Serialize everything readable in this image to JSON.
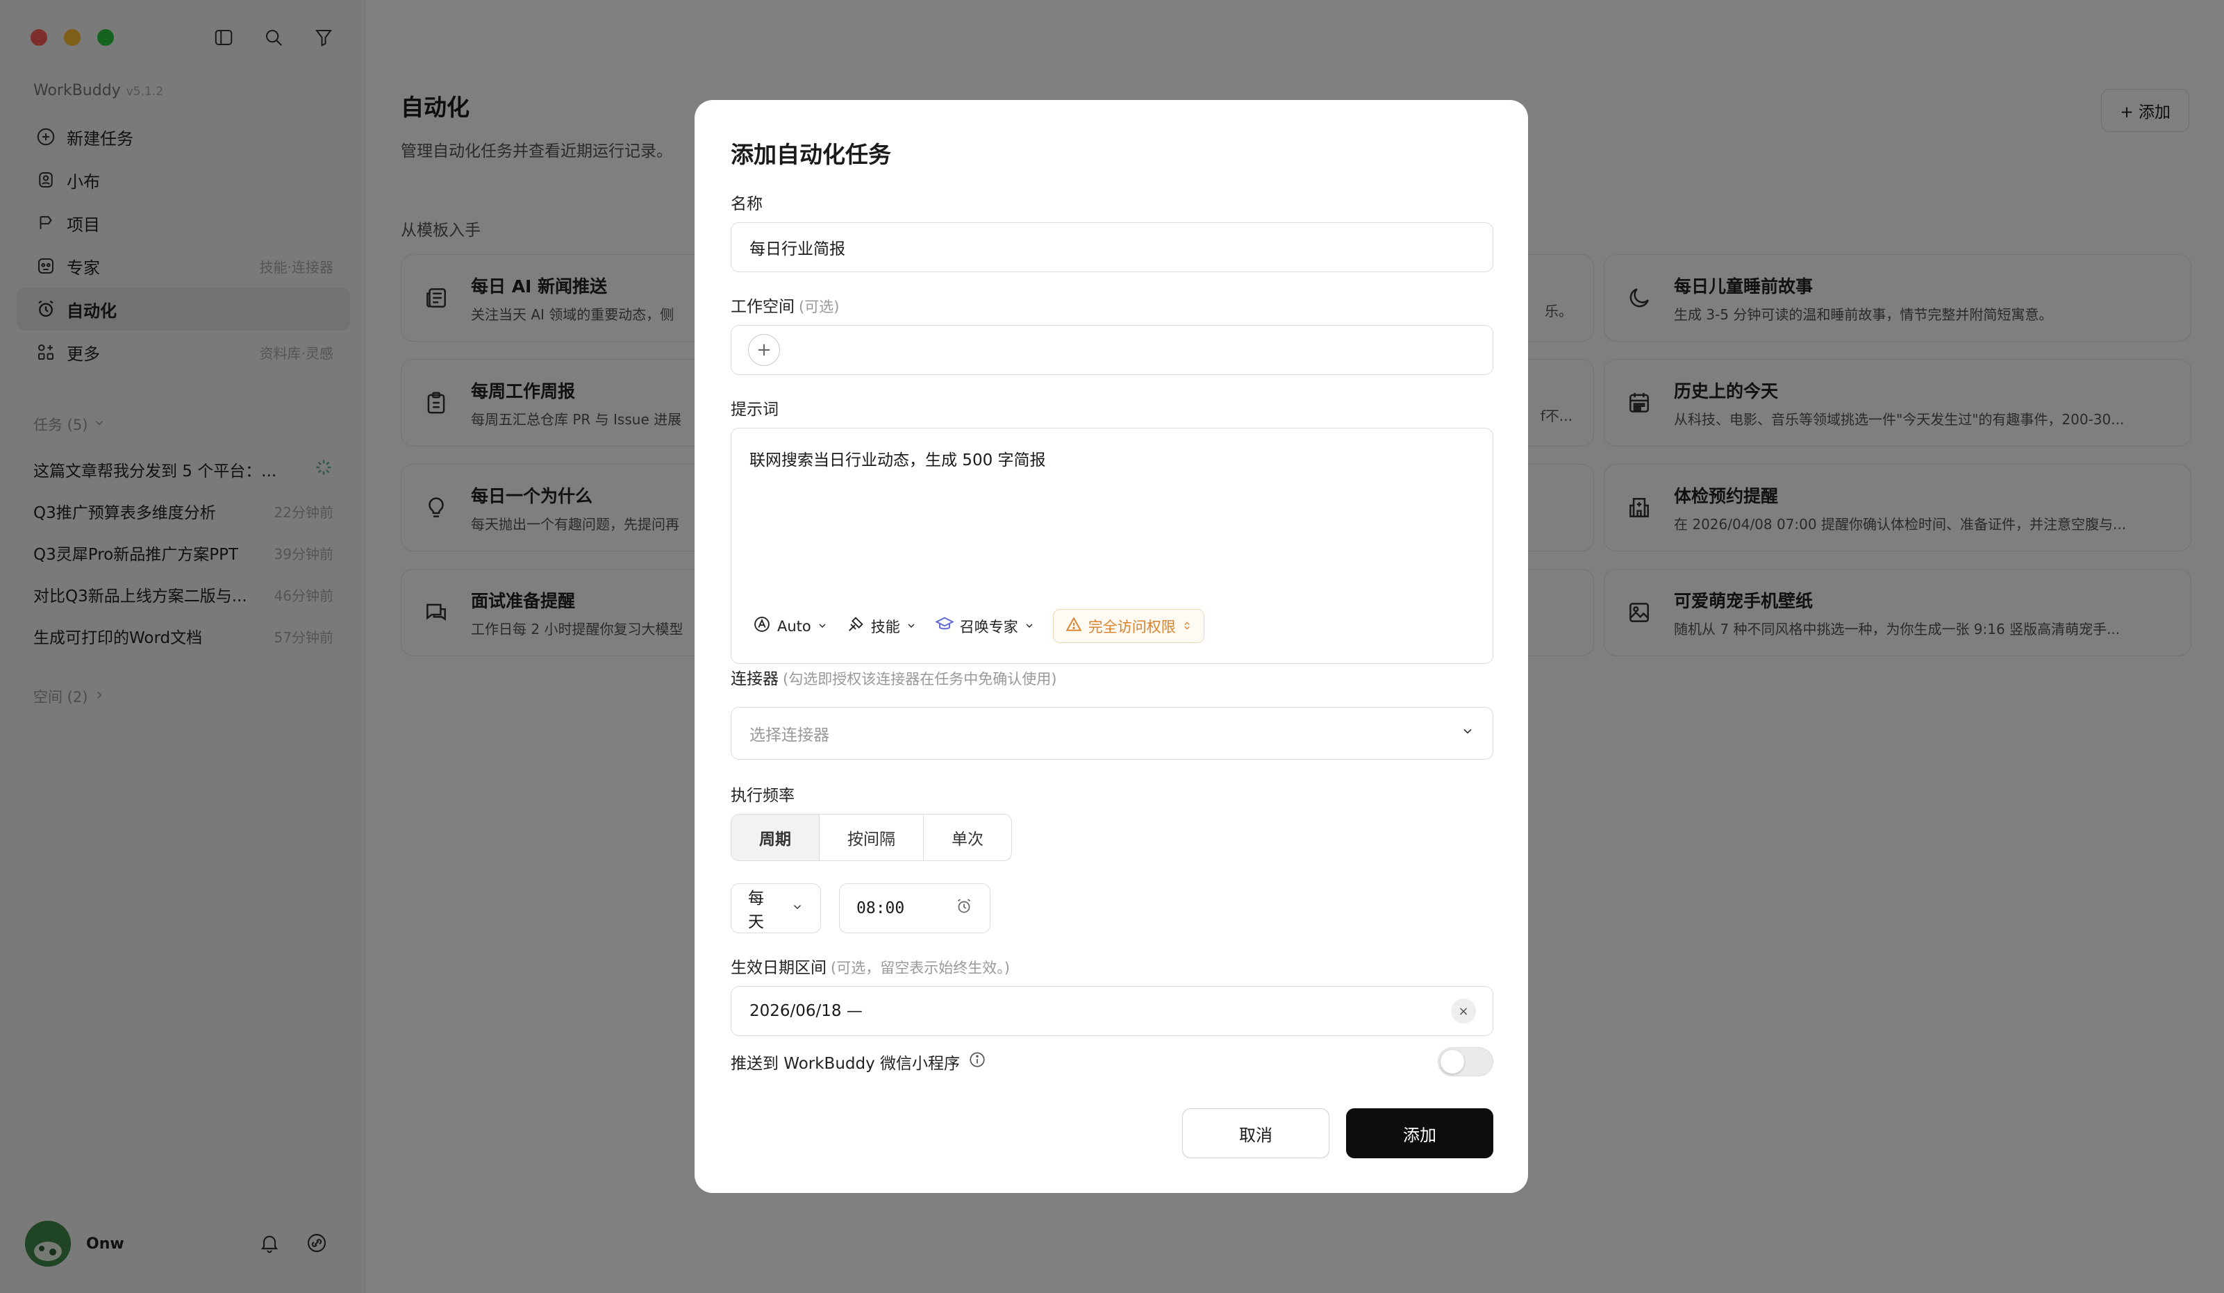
{
  "sidebar": {
    "brand": "WorkBuddy",
    "version": "v5.1.2",
    "nav": [
      {
        "label": "新建任务",
        "hint": ""
      },
      {
        "label": "小布",
        "hint": ""
      },
      {
        "label": "项目",
        "hint": ""
      },
      {
        "label": "专家",
        "hint": "技能·连接器"
      },
      {
        "label": "自动化",
        "hint": ""
      },
      {
        "label": "更多",
        "hint": "资料库·灵感"
      }
    ],
    "tasks_header": "任务 (5)",
    "tasks": [
      {
        "title": "这篇文章帮我分发到 5 个平台：...",
        "time": ""
      },
      {
        "title": "Q3推广预算表多维度分析",
        "time": "22分钟前"
      },
      {
        "title": "Q3灵犀Pro新品推广方案PPT",
        "time": "39分钟前"
      },
      {
        "title": "对比Q3新品上线方案二版与...",
        "time": "46分钟前"
      },
      {
        "title": "生成可打印的Word文档",
        "time": "57分钟前"
      }
    ],
    "spaces_header": "空间 (2)",
    "user_name": "Onw"
  },
  "main": {
    "title": "自动化",
    "description": "管理自动化任务并查看近期运行记录。",
    "add_button": "+ 添加",
    "templates_label": "从模板入手",
    "left_cards": [
      {
        "title": "每日 AI 新闻推送",
        "desc": "关注当天 AI 领域的重要动态，侧",
        "icon": "newspaper-icon"
      },
      {
        "title": "每周工作周报",
        "desc": "每周五汇总仓库 PR 与 Issue 进展",
        "icon": "clipboard-icon"
      },
      {
        "title": "每日一个为什么",
        "desc": "每天抛出一个有趣问题，先提问再",
        "icon": "lightbulb-icon"
      },
      {
        "title": "面试准备提醒",
        "desc": "工作日每 2 小时提醒你复习大模型",
        "icon": "chat-icon"
      }
    ],
    "middle_fragments": [
      "乐。",
      "f不..."
    ],
    "right_cards": [
      {
        "title": "每日儿童睡前故事",
        "desc": "生成 3-5 分钟可读的温和睡前故事，情节完整并附简短寓意。",
        "icon": "moon-icon"
      },
      {
        "title": "历史上的今天",
        "desc": "从科技、电影、音乐等领域挑选一件\"今天发生过\"的有趣事件，200-30...",
        "icon": "calendar-icon"
      },
      {
        "title": "体检预约提醒",
        "desc": "在 2026/04/08 07:00 提醒你确认体检时间、准备证件，并注意空腹与...",
        "icon": "hospital-icon"
      },
      {
        "title": "可爱萌宠手机壁纸",
        "desc": "随机从 7 种不同风格中挑选一种，为你生成一张 9:16 竖版高清萌宠手...",
        "icon": "image-icon"
      }
    ]
  },
  "modal": {
    "title": "添加自动化任务",
    "name_label": "名称",
    "name_value": "每日行业简报",
    "workspace_label": "工作空间",
    "workspace_optional": "(可选)",
    "prompt_label": "提示词",
    "prompt_value": "联网搜索当日行业动态，生成 500 字简报",
    "tools": {
      "auto": "Auto",
      "skills": "技能",
      "expert": "召唤专家",
      "permission": "完全访问权限"
    },
    "connector_label": "连接器",
    "connector_hint": "(勾选即授权该连接器在任务中免确认使用)",
    "connector_placeholder": "选择连接器",
    "freq_label": "执行频率",
    "freq_tabs": [
      "周期",
      "按间隔",
      "单次"
    ],
    "freq_active": "周期",
    "period_value": "每天",
    "time_value": "08:00",
    "date_label": "生效日期区间",
    "date_hint": "(可选，留空表示始终生效。)",
    "date_value": "2026/06/18 —",
    "push_label": "推送到 WorkBuddy 微信小程序",
    "push_enabled": false,
    "cancel": "取消",
    "submit": "添加"
  },
  "colors": {
    "primary_button": "#0d0d0d",
    "permission_warn": "#d9822b",
    "overlay": "rgba(0,0,0,0.5)"
  }
}
